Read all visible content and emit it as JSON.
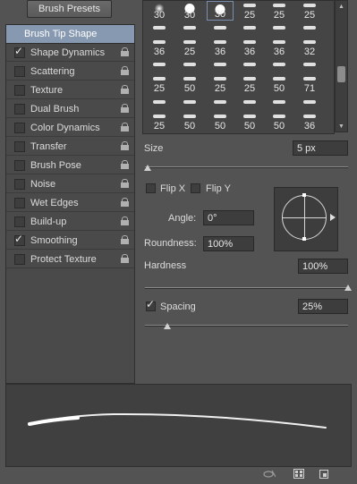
{
  "presets_button": "Brush Presets",
  "options": [
    {
      "label": "Brush Tip Shape",
      "header": true
    },
    {
      "label": "Shape Dynamics",
      "checked": true,
      "lock": true
    },
    {
      "label": "Scattering",
      "checked": false,
      "lock": true
    },
    {
      "label": "Texture",
      "checked": false,
      "lock": true
    },
    {
      "label": "Dual Brush",
      "checked": false,
      "lock": true
    },
    {
      "label": "Color Dynamics",
      "checked": false,
      "lock": true
    },
    {
      "label": "Transfer",
      "checked": false,
      "lock": true
    },
    {
      "label": "Brush Pose",
      "checked": false,
      "lock": true
    },
    {
      "label": "Noise",
      "checked": false,
      "lock": true
    },
    {
      "label": "Wet Edges",
      "checked": false,
      "lock": true
    },
    {
      "label": "Build-up",
      "checked": false,
      "lock": true
    },
    {
      "label": "Smoothing",
      "checked": true,
      "lock": true
    },
    {
      "label": "Protect Texture",
      "checked": false,
      "lock": true
    }
  ],
  "brush_grid": [
    [
      "30",
      "30",
      "30",
      "25",
      "25",
      "25"
    ],
    [
      "",
      "",
      "",
      "",
      "",
      ""
    ],
    [
      "36",
      "25",
      "36",
      "36",
      "36",
      "32"
    ],
    [
      "",
      "",
      "",
      "",
      "",
      ""
    ],
    [
      "25",
      "50",
      "25",
      "25",
      "50",
      "71"
    ],
    [
      "",
      "",
      "",
      "",
      "",
      ""
    ],
    [
      "25",
      "50",
      "50",
      "50",
      "50",
      "36"
    ]
  ],
  "size": {
    "label": "Size",
    "value": "5 px"
  },
  "flip_x": "Flip X",
  "flip_y": "Flip Y",
  "angle": {
    "label": "Angle:",
    "value": "0°"
  },
  "roundness": {
    "label": "Roundness:",
    "value": "100%"
  },
  "hardness": {
    "label": "Hardness",
    "value": "100%"
  },
  "spacing": {
    "label": "Spacing",
    "value": "25%",
    "checked": true
  },
  "icons": [
    "checkmark-icon",
    "lock-icon",
    "angle-arrow-icon",
    "visibility-toggle-icon",
    "grid-panel-icon",
    "new-preset-icon"
  ]
}
